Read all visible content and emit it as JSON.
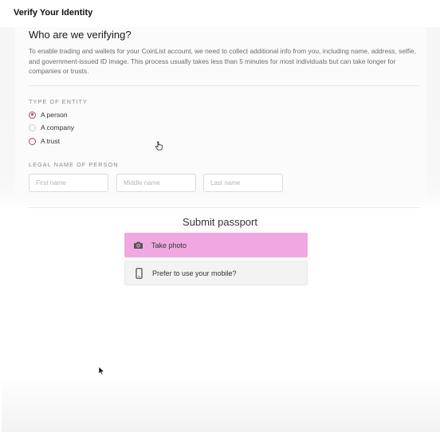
{
  "window": {
    "title": "Verify Your Identity"
  },
  "verify": {
    "heading": "Who are we verifying?",
    "intro": "To enable trading and wallets for your CoinList account, we need to collect additional info from you, including name, address, selfie, and government-issued ID image. This process usually takes less than 5 minutes for most individuals but can take longer for companies or trusts.",
    "entity_label": "TYPE OF ENTITY",
    "entity_options": [
      {
        "label": "A person",
        "selected": true
      },
      {
        "label": "A company",
        "selected": false
      },
      {
        "label": "A trust",
        "selected": false
      }
    ],
    "name_label": "LEGAL NAME OF PERSON",
    "fields": {
      "first": {
        "placeholder": "First name",
        "value": ""
      },
      "middle": {
        "placeholder": "Middle name",
        "value": ""
      },
      "last": {
        "placeholder": "Last name",
        "value": ""
      }
    }
  },
  "passport": {
    "title": "Submit passport",
    "options": [
      {
        "label": "Take photo",
        "icon": "camera-icon"
      },
      {
        "label": "Prefer to use your mobile?",
        "icon": "mobile-phone-icon"
      }
    ]
  },
  "colors": {
    "accent": "#b23a6b",
    "take_photo_bg": "#f0a8e1",
    "mobile_option_bg": "#f3f3f3"
  }
}
